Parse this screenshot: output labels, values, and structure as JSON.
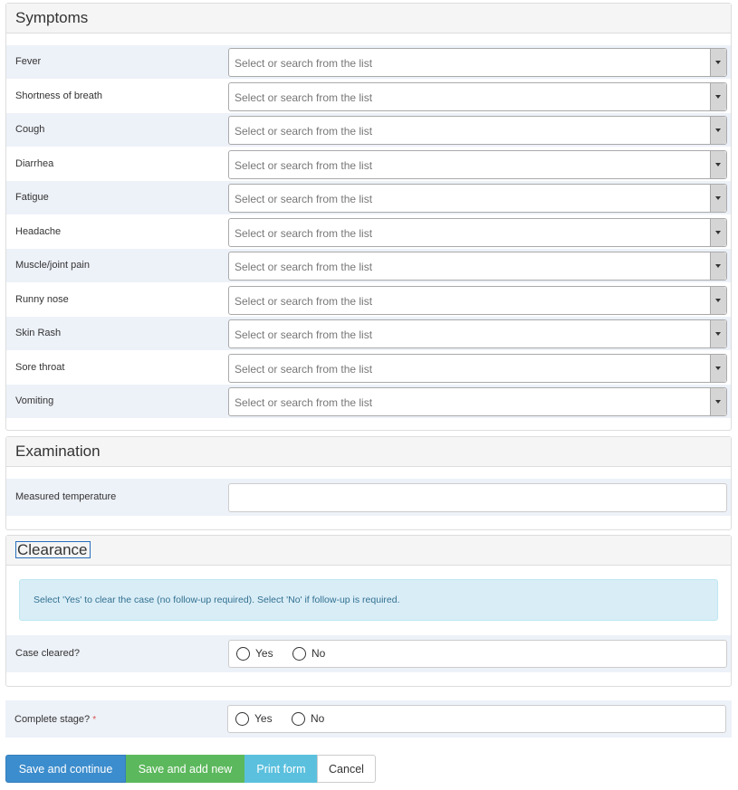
{
  "symptoms": {
    "title": "Symptoms",
    "placeholder": "Select or search from the list",
    "items": [
      {
        "label": "Fever"
      },
      {
        "label": "Shortness of breath"
      },
      {
        "label": "Cough"
      },
      {
        "label": "Diarrhea"
      },
      {
        "label": "Fatigue"
      },
      {
        "label": "Headache"
      },
      {
        "label": "Muscle/joint pain"
      },
      {
        "label": "Runny nose"
      },
      {
        "label": "Skin Rash"
      },
      {
        "label": "Sore throat"
      },
      {
        "label": "Vomiting"
      }
    ]
  },
  "examination": {
    "title": "Examination",
    "temperature_label": "Measured temperature",
    "temperature_value": ""
  },
  "clearance": {
    "title": "Clearance",
    "info": "Select 'Yes' to clear the case (no follow-up required). Select 'No' if follow-up is required.",
    "case_cleared_label": "Case cleared?",
    "yes": "Yes",
    "no": "No"
  },
  "complete_stage": {
    "label": "Complete stage?",
    "required_marker": "*",
    "yes": "Yes",
    "no": "No"
  },
  "buttons": {
    "save_continue": "Save and continue",
    "save_add_new": "Save and add new",
    "print_form": "Print form",
    "cancel": "Cancel"
  },
  "colors": {
    "primary": "#3c8dcd",
    "success": "#5cb85c",
    "info": "#5bc0de",
    "row_shade": "#edf1f8"
  }
}
